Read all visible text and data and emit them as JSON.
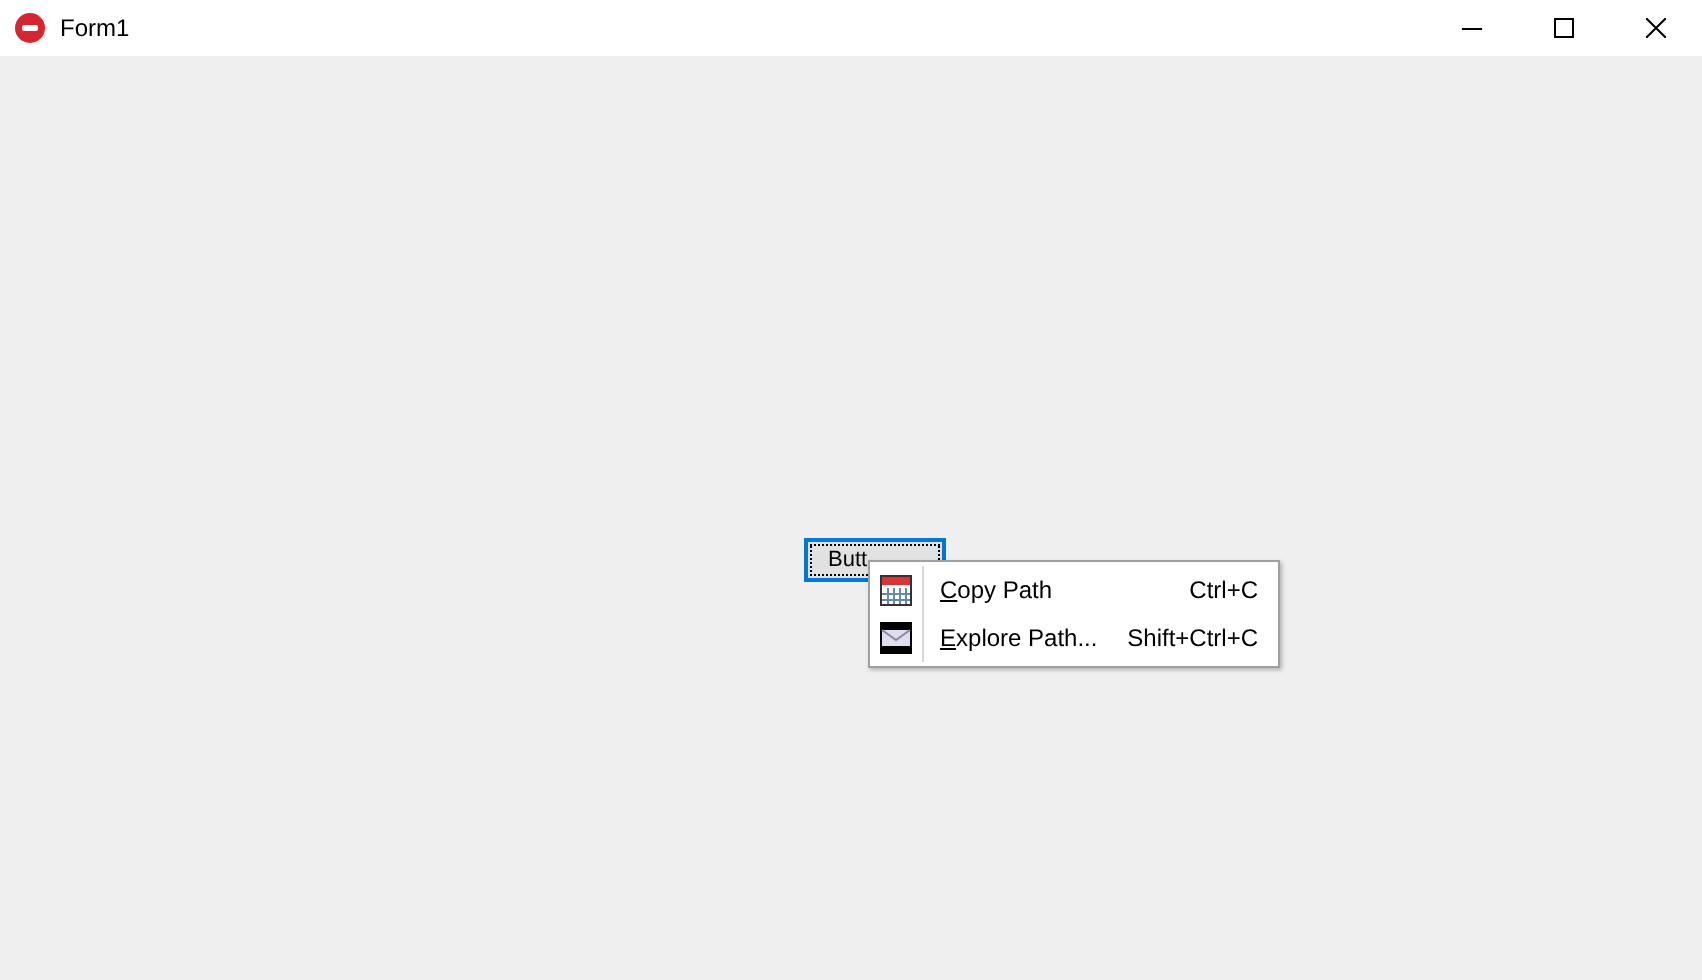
{
  "window": {
    "title": "Form1"
  },
  "button": {
    "label": "Butt",
    "focused": true
  },
  "context_menu": {
    "items": [
      {
        "label": "Copy Path",
        "shortcut": "Ctrl+C"
      },
      {
        "label": "Explore Path...",
        "shortcut": "Shift+Ctrl+C"
      }
    ]
  }
}
